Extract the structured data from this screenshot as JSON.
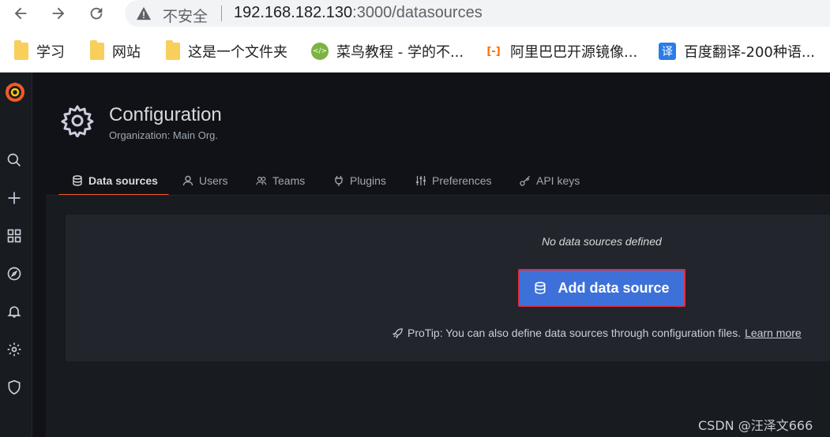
{
  "browser": {
    "security_label": "不安全",
    "url_host": "192.168.182.130",
    "url_rest": ":3000/datasources",
    "bookmarks": [
      {
        "label": "学习",
        "icon": "folder-icon"
      },
      {
        "label": "网站",
        "icon": "folder-icon"
      },
      {
        "label": "这是一个文件夹",
        "icon": "folder-icon"
      },
      {
        "label": "菜鸟教程 - 学的不...",
        "icon": "runoob-icon"
      },
      {
        "label": "阿里巴巴开源镜像...",
        "icon": "aliyun-icon"
      },
      {
        "label": "百度翻译-200种语...",
        "icon": "baidu-translate-icon"
      }
    ],
    "runoob_glyph": "</>",
    "ali_glyph": "[-]",
    "baidu_glyph": "译"
  },
  "header": {
    "title": "Configuration",
    "subtitle": "Organization: Main Org."
  },
  "tabs": [
    {
      "label": "Data sources",
      "icon": "database-icon",
      "active": true
    },
    {
      "label": "Users",
      "icon": "user-icon"
    },
    {
      "label": "Teams",
      "icon": "users-icon"
    },
    {
      "label": "Plugins",
      "icon": "plug-icon"
    },
    {
      "label": "Preferences",
      "icon": "sliders-icon"
    },
    {
      "label": "API keys",
      "icon": "key-icon"
    }
  ],
  "empty_state": {
    "title": "No data sources defined",
    "button_label": "Add data source",
    "protip": "ProTip: You can also define data sources through configuration files.",
    "learn_more": "Learn more"
  },
  "watermark": "CSDN @汪泽文666",
  "colors": {
    "accent": "#f05a28",
    "primary_button": "#3d71d9",
    "highlight_border": "#e02f44"
  }
}
